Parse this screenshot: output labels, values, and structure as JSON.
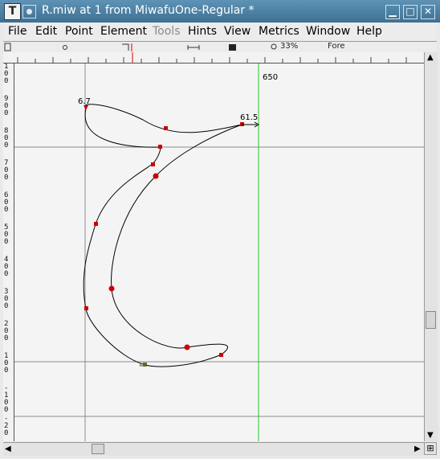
{
  "window": {
    "title": "R.miw at 1 from MiwafuOne-Regular *",
    "app_icon_glyph": "T",
    "minimize_glyph": "▁",
    "maximize_glyph": "□",
    "close_glyph": "✕"
  },
  "menubar": {
    "items": [
      {
        "label": "File",
        "enabled": true
      },
      {
        "label": "Edit",
        "enabled": true
      },
      {
        "label": "Point",
        "enabled": true
      },
      {
        "label": "Element",
        "enabled": true
      },
      {
        "label": "Tools",
        "enabled": false
      },
      {
        "label": "Hints",
        "enabled": true
      },
      {
        "label": "View",
        "enabled": true
      },
      {
        "label": "Metrics",
        "enabled": true
      },
      {
        "label": "Window",
        "enabled": true
      },
      {
        "label": "Help",
        "enabled": true
      }
    ]
  },
  "toolrow": {
    "zoom": "33%",
    "layer": "Fore"
  },
  "canvas": {
    "labels": {
      "advance_width": "650",
      "left_point": "6.7",
      "right_point": "61.5"
    }
  },
  "colors": {
    "titlebar": "#4a7fa3",
    "guide_green": "#22cc22",
    "point_red": "#cc0000",
    "outline": "#000000",
    "canvas_bg": "#f4f4f4"
  },
  "icons": {
    "scroll_up": "▲",
    "scroll_down": "▼",
    "scroll_left": "◀",
    "scroll_right": "▶"
  }
}
